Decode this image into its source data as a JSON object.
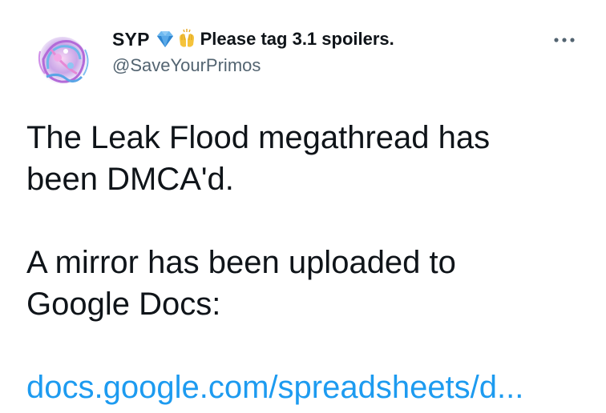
{
  "tweet": {
    "author": {
      "display_name": "SYP",
      "name_suffix": "Please tag 3.1 spoilers.",
      "handle": "@SaveYourPrimos",
      "emojis": [
        "gem-emoji",
        "raising-hands-emoji"
      ],
      "avatar_icon": "avatar-image"
    },
    "more_icon": "more-options-icon",
    "text_para1_line1": "The Leak Flood megathread has",
    "text_para1_line2": "been DMCA'd.",
    "text_para2_line1": "A mirror has been uploaded to",
    "text_para2_line2": "Google Docs:",
    "link_text": "docs.google.com/spreadsheets/d...",
    "colors": {
      "text": "#0f1419",
      "secondary": "#536471",
      "link": "#1d9bf0",
      "background": "#ffffff"
    }
  }
}
